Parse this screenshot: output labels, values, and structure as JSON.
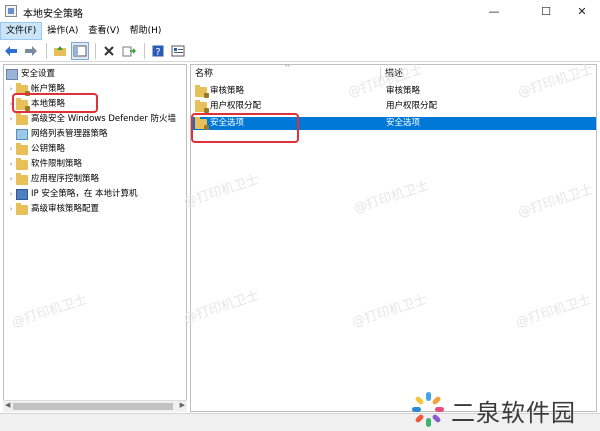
{
  "window": {
    "title": "本地安全策略",
    "minimize_glyph": "—",
    "maximize_glyph": "☐",
    "close_glyph": "✕"
  },
  "menu": [
    {
      "label": "文件(F)",
      "active": true
    },
    {
      "label": "操作(A)"
    },
    {
      "label": "查看(V)"
    },
    {
      "label": "帮助(H)"
    }
  ],
  "toolbar": {
    "icons": [
      "back-arrow-icon",
      "forward-arrow-icon",
      "up-folder-icon",
      "show-tree-icon",
      "delete-icon",
      "export-icon",
      "help-icon",
      "properties-icon"
    ]
  },
  "tree": {
    "root": "安全设置",
    "items": [
      {
        "label": "帐户策略"
      },
      {
        "label": "本地策略",
        "selected": true
      },
      {
        "label": "高级安全 Windows Defender 防火墙"
      },
      {
        "label": "网络列表管理器策略"
      },
      {
        "label": "公钥策略"
      },
      {
        "label": "软件限制策略"
      },
      {
        "label": "应用程序控制策略"
      },
      {
        "label": "IP 安全策略，在 本地计算机"
      },
      {
        "label": "高级审核策略配置"
      }
    ]
  },
  "list": {
    "columns": {
      "name": "名称",
      "description": "描述"
    },
    "rows": [
      {
        "name": "审核策略",
        "description": "审核策略"
      },
      {
        "name": "用户权限分配",
        "description": "用户权限分配"
      },
      {
        "name": "安全选项",
        "description": "安全选项",
        "selected": true
      }
    ]
  },
  "watermark": "@打印机卫士",
  "brand": {
    "name": "二泉软件园"
  },
  "colors": {
    "selection": "#0078d7",
    "highlight_box": "#e0313a",
    "folder": "#e8c05a"
  }
}
